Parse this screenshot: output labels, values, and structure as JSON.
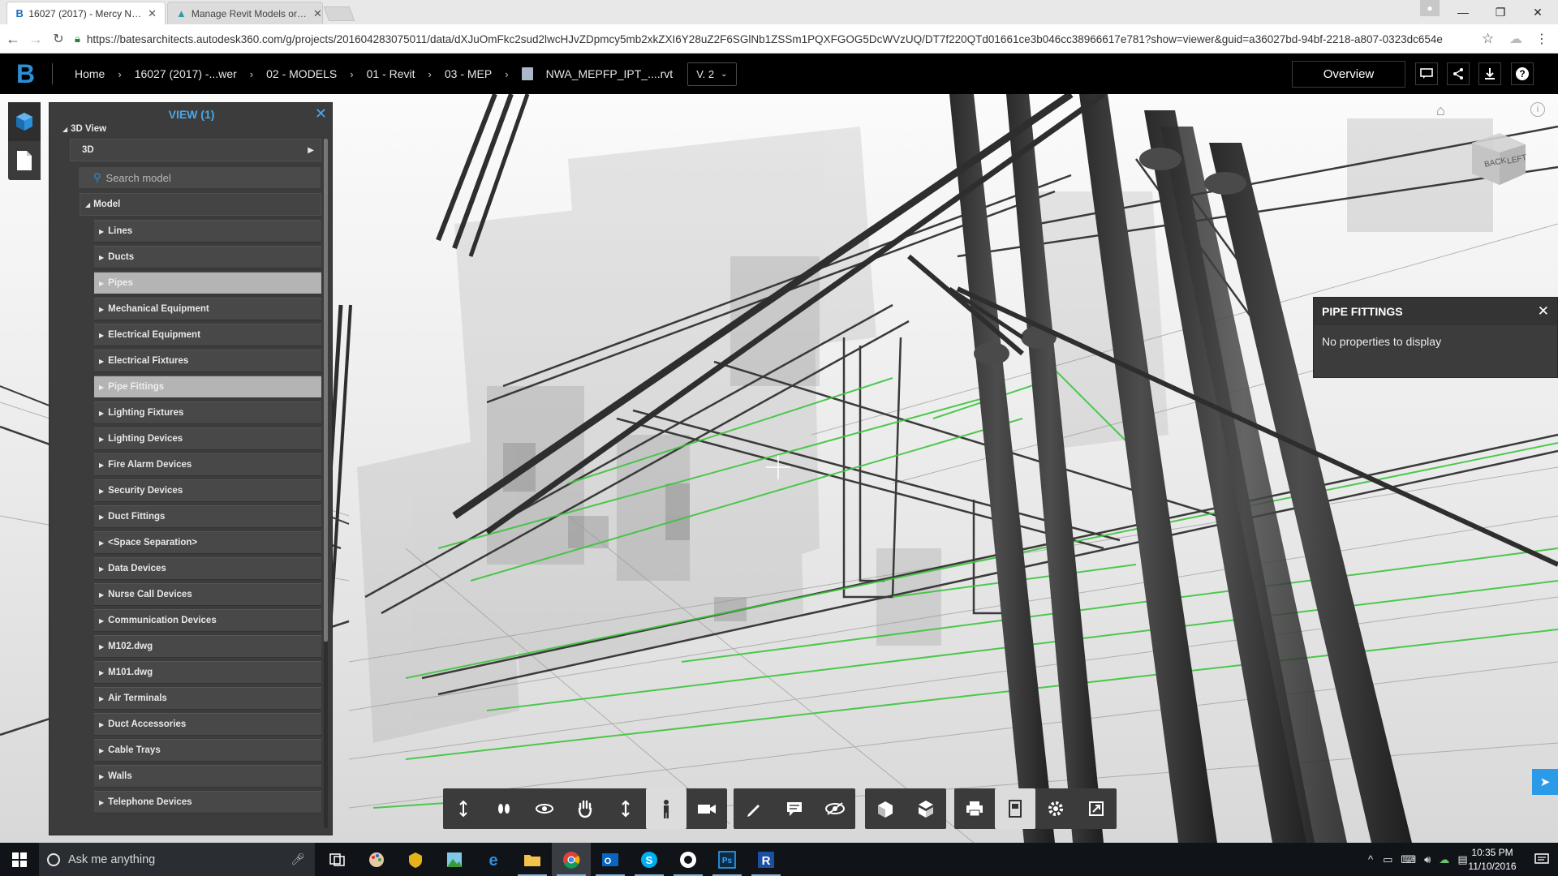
{
  "browser": {
    "tabs": [
      {
        "title": "16027 (2017) - Mercy N…",
        "favicon": "bim360-b",
        "active": true
      },
      {
        "title": "Manage Revit Models or…",
        "favicon": "autodesk-a",
        "active": false
      }
    ],
    "url": "https://batesarchitects.autodesk360.com/g/projects/201604283075011/data/dXJuOmFkc2sud2lwcHJvZDpmcy5mb2xkZXI6Y28uZ2F6SGlNb1ZSSm1PQXFGOG5DcWVzUQ/DT7f220QTd01661ce3b046cc38966617e781?show=viewer&guid=a36027bd-94bf-2218-a807-0323dc654e"
  },
  "app": {
    "logo": "B",
    "breadcrumbs": [
      "Home",
      "16027 (2017) -...wer",
      "02 - MODELS",
      "01 - Revit",
      "03 - MEP",
      "NWA_MEPFP_IPT_....rvt"
    ],
    "version": "V. 2",
    "overview_label": "Overview"
  },
  "model_browser": {
    "title": "VIEW (1)",
    "view_group": "3D View",
    "view_item": "3D",
    "search_placeholder": "Search model",
    "root": "Model",
    "categories": [
      {
        "label": "Lines",
        "selected": false
      },
      {
        "label": "Ducts",
        "selected": false
      },
      {
        "label": "Pipes",
        "selected": true
      },
      {
        "label": "Mechanical Equipment",
        "selected": false
      },
      {
        "label": "Electrical Equipment",
        "selected": false
      },
      {
        "label": "Electrical Fixtures",
        "selected": false
      },
      {
        "label": "Pipe Fittings",
        "selected": true
      },
      {
        "label": "Lighting Fixtures",
        "selected": false
      },
      {
        "label": "Lighting Devices",
        "selected": false
      },
      {
        "label": "Fire Alarm Devices",
        "selected": false
      },
      {
        "label": "Security Devices",
        "selected": false
      },
      {
        "label": "Duct Fittings",
        "selected": false
      },
      {
        "label": "<Space Separation>",
        "selected": false
      },
      {
        "label": "Data Devices",
        "selected": false
      },
      {
        "label": "Nurse Call Devices",
        "selected": false
      },
      {
        "label": "Communication Devices",
        "selected": false
      },
      {
        "label": "M102.dwg",
        "selected": false
      },
      {
        "label": "M101.dwg",
        "selected": false
      },
      {
        "label": "Air Terminals",
        "selected": false
      },
      {
        "label": "Duct Accessories",
        "selected": false
      },
      {
        "label": "Cable Trays",
        "selected": false
      },
      {
        "label": "Walls",
        "selected": false
      },
      {
        "label": "Telephone Devices",
        "selected": false
      }
    ]
  },
  "properties": {
    "title": "PIPE FITTINGS",
    "message": "No properties to display"
  },
  "viewcube": {
    "face_back": "BACK",
    "face_left": "LEFT"
  },
  "toolbar_groups": [
    [
      "orbit-tool-icon",
      "look-tool-icon",
      "spin-tool-icon",
      "pan-tool-icon",
      "zoom-tool-icon",
      "first-person-icon",
      "camera-icon"
    ],
    [
      "markup-icon",
      "comment-icon",
      "visibility-icon"
    ],
    [
      "explode-icon",
      "section-icon"
    ],
    [
      "print-icon",
      "model-browser-icon",
      "settings-icon",
      "fullscreen-icon"
    ]
  ],
  "taskbar": {
    "search_placeholder": "Ask me anything",
    "time": "10:35 PM",
    "date": "11/10/2016"
  },
  "colors": {
    "accent": "#2b8fd8",
    "panel_title": "#4aa8ea",
    "highlight_pipes": "#3ec43e",
    "panel_bg": "#3c3c3c"
  }
}
